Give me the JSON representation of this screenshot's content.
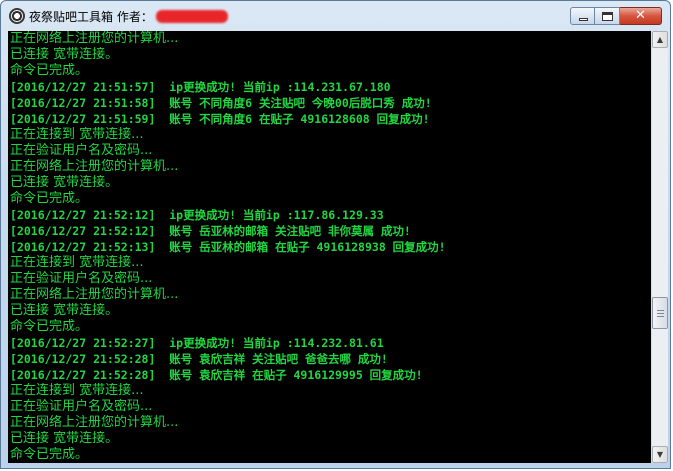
{
  "window": {
    "title": "夜祭贴吧工具箱 作者：",
    "minimize_icon": "minimize-icon",
    "maximize_icon": "maximize-icon",
    "close_icon": "close-icon",
    "close_glyph": "✕"
  },
  "console": {
    "text_color": "#21d642",
    "background": "#000000",
    "lines": [
      {
        "text": "正在网络上注册您的计算机...",
        "kind": "msg"
      },
      {
        "text": "已连接 宽带连接。",
        "kind": "msg"
      },
      {
        "text": "命令已完成。",
        "kind": "msg"
      },
      {
        "text": "[2016/12/27 21:51:57]  ip更换成功! 当前ip :114.231.67.180",
        "kind": "log"
      },
      {
        "text": "[2016/12/27 21:51:58]  账号 不同角度6 关注贴吧 今晚00后脱口秀 成功!",
        "kind": "log"
      },
      {
        "text": "[2016/12/27 21:51:59]  账号 不同角度6 在贴子 4916128608 回复成功!",
        "kind": "log"
      },
      {
        "text": "正在连接到 宽带连接...",
        "kind": "msg"
      },
      {
        "text": "正在验证用户名及密码...",
        "kind": "msg"
      },
      {
        "text": "正在网络上注册您的计算机...",
        "kind": "msg"
      },
      {
        "text": "已连接 宽带连接。",
        "kind": "msg"
      },
      {
        "text": "命令已完成。",
        "kind": "msg"
      },
      {
        "text": "[2016/12/27 21:52:12]  ip更换成功! 当前ip :117.86.129.33",
        "kind": "log"
      },
      {
        "text": "[2016/12/27 21:52:12]  账号 岳亚林的邮箱 关注贴吧 非你莫属 成功!",
        "kind": "log"
      },
      {
        "text": "[2016/12/27 21:52:13]  账号 岳亚林的邮箱 在贴子 4916128938 回复成功!",
        "kind": "log"
      },
      {
        "text": "正在连接到 宽带连接...",
        "kind": "msg"
      },
      {
        "text": "正在验证用户名及密码...",
        "kind": "msg"
      },
      {
        "text": "正在网络上注册您的计算机...",
        "kind": "msg"
      },
      {
        "text": "已连接 宽带连接。",
        "kind": "msg"
      },
      {
        "text": "命令已完成。",
        "kind": "msg"
      },
      {
        "text": "[2016/12/27 21:52:27]  ip更换成功! 当前ip :114.232.81.61",
        "kind": "log"
      },
      {
        "text": "[2016/12/27 21:52:28]  账号 袁欣吉祥 关注贴吧 爸爸去哪 成功!",
        "kind": "log"
      },
      {
        "text": "[2016/12/27 21:52:28]  账号 袁欣吉祥 在贴子 4916129995 回复成功!",
        "kind": "log"
      },
      {
        "text": "正在连接到 宽带连接...",
        "kind": "msg"
      },
      {
        "text": "正在验证用户名及密码...",
        "kind": "msg"
      },
      {
        "text": "正在网络上注册您的计算机...",
        "kind": "msg"
      },
      {
        "text": "已连接 宽带连接。",
        "kind": "msg"
      },
      {
        "text": "命令已完成。",
        "kind": "msg"
      }
    ]
  },
  "scrollbar": {
    "up_arrow": "▲",
    "down_arrow": "▼",
    "position_fraction": 0.68
  }
}
